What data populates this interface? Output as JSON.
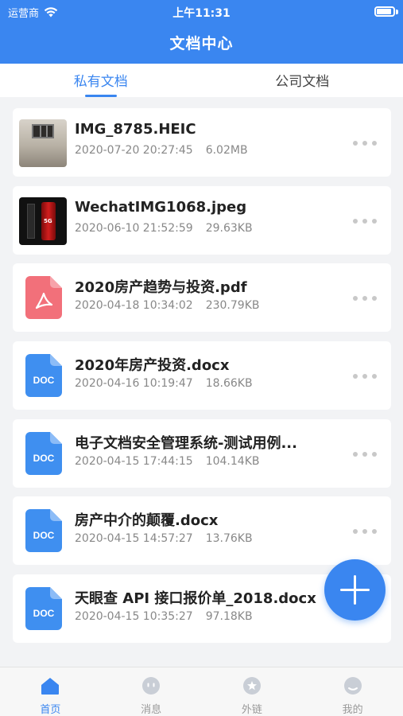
{
  "status_bar": {
    "carrier": "运营商",
    "time": "上午11:31"
  },
  "header": {
    "title": "文档中心"
  },
  "tabs": [
    {
      "label": "私有文档",
      "active": true
    },
    {
      "label": "公司文档",
      "active": false
    }
  ],
  "files": [
    {
      "name": "IMG_8785.HEIC",
      "date": "2020-07-20 20:27:45",
      "size": "6.02MB",
      "icon": "image-thumbnail-room"
    },
    {
      "name": "WechatIMG1068.jpeg",
      "date": "2020-06-10 21:52:59",
      "size": "29.63KB",
      "icon": "image-thumbnail-phone"
    },
    {
      "name": "2020房产趋势与投资.pdf",
      "date": "2020-04-18 10:34:02",
      "size": "230.79KB",
      "icon": "pdf-icon"
    },
    {
      "name": "2020年房产投资.docx",
      "date": "2020-04-16 10:19:47",
      "size": "18.66KB",
      "icon": "doc-icon"
    },
    {
      "name": "电子文档安全管理系统-测试用例...",
      "date": "2020-04-15 17:44:15",
      "size": "104.14KB",
      "icon": "doc-icon"
    },
    {
      "name": "房产中介的颠覆.docx",
      "date": "2020-04-15 14:57:27",
      "size": "13.76KB",
      "icon": "doc-icon"
    },
    {
      "name": "天眼查 API 接口报价单_2018.docx",
      "date": "2020-04-15 10:35:27",
      "size": "97.18KB",
      "icon": "doc-icon"
    }
  ],
  "doc_icon_text": "DOC",
  "phone_thumb_text": "5G",
  "bottom_nav": [
    {
      "label": "首页",
      "icon": "home-icon",
      "active": true
    },
    {
      "label": "消息",
      "icon": "message-icon",
      "active": false
    },
    {
      "label": "外链",
      "icon": "link-star-icon",
      "active": false
    },
    {
      "label": "我的",
      "icon": "profile-icon",
      "active": false
    }
  ],
  "colors": {
    "accent": "#3a86f0",
    "pdf": "#f2707a",
    "doc": "#3f8ff0",
    "inactive": "#c9ced6"
  }
}
